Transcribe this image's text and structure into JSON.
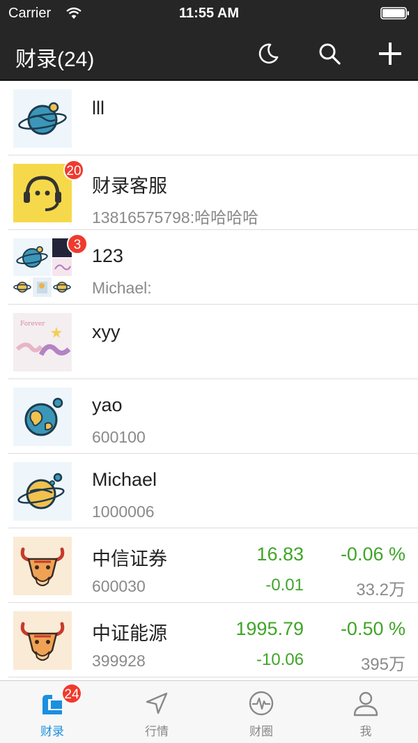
{
  "status_bar": {
    "carrier": "Carrier",
    "time": "11:55 AM"
  },
  "header": {
    "title": "财录(24)",
    "icons": [
      "moon-icon",
      "search-icon",
      "add-icon"
    ]
  },
  "conversations": [
    {
      "name": "lll",
      "subtitle": "",
      "avatar": "planet-teal-avatar"
    },
    {
      "name": "财录客服",
      "subtitle": "13816575798:哈哈哈哈",
      "badge": "20",
      "avatar": "headset-avatar"
    },
    {
      "name": "123",
      "subtitle": "Michael:",
      "badge": "3",
      "avatar": "group-grid-avatar"
    },
    {
      "name": "xyy",
      "subtitle": "",
      "avatar": "photo-avatar"
    },
    {
      "name": "yao",
      "subtitle": "600100",
      "avatar": "earth-avatar"
    },
    {
      "name": "Michael",
      "subtitle": "1000006",
      "avatar": "saturn-avatar"
    }
  ],
  "stocks": [
    {
      "name": "中信证券",
      "code": "600030",
      "price": "16.83",
      "change_pct": "-0.06 %",
      "change": "-0.01",
      "volume": "33.2万"
    },
    {
      "name": "中证能源",
      "code": "399928",
      "price": "1995.79",
      "change_pct": "-0.50 %",
      "change": "-10.06",
      "volume": "395万"
    }
  ],
  "tab_bar": {
    "badge": "24",
    "tabs": [
      {
        "label": "财录",
        "icon": "chat-tab-icon",
        "active": true
      },
      {
        "label": "行情",
        "icon": "navigation-icon"
      },
      {
        "label": "财圈",
        "icon": "pulse-icon"
      },
      {
        "label": "我",
        "icon": "person-icon"
      }
    ]
  },
  "colors": {
    "header_bg": "#262626",
    "down_green": "#3fa528",
    "badge_red": "#f03a2e",
    "tab_active": "#1b8fe0"
  }
}
